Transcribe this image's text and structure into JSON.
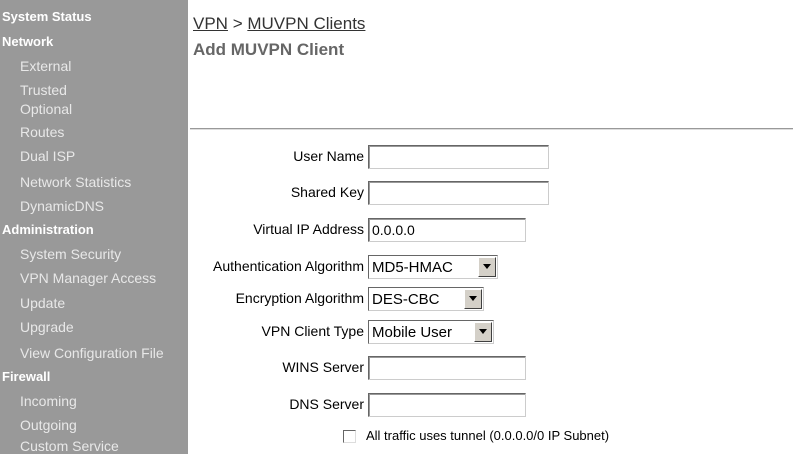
{
  "sidebar": {
    "system_status": "System Status",
    "network": {
      "label": "Network",
      "items": [
        "External",
        "Trusted",
        "Optional",
        "Routes",
        "Dual ISP",
        "Network Statistics",
        "DynamicDNS"
      ]
    },
    "administration": {
      "label": "Administration",
      "items": [
        "System Security",
        "VPN Manager Access",
        "Update",
        "Upgrade",
        "View Configuration File"
      ]
    },
    "firewall": {
      "label": "Firewall",
      "items": [
        "Incoming",
        "Outgoing",
        "Custom Service"
      ]
    }
  },
  "breadcrumb": {
    "part1": "VPN",
    "sep": " > ",
    "part2": "MUVPN Clients"
  },
  "page_title": "Add MUVPN Client",
  "form": {
    "user_name": {
      "label": "User Name",
      "value": ""
    },
    "shared_key": {
      "label": "Shared Key",
      "value": ""
    },
    "virtual_ip": {
      "label": "Virtual IP Address",
      "value": "0.0.0.0"
    },
    "auth_alg": {
      "label": "Authentication Algorithm",
      "value": "MD5-HMAC"
    },
    "enc_alg": {
      "label": "Encryption Algorithm",
      "value": "DES-CBC"
    },
    "client_type": {
      "label": "VPN Client Type",
      "value": "Mobile User"
    },
    "wins": {
      "label": "WINS Server",
      "value": ""
    },
    "dns": {
      "label": "DNS Server",
      "value": ""
    },
    "tunnel": {
      "label": "All traffic uses tunnel (0.0.0.0/0 IP Subnet)",
      "checked": false
    }
  },
  "colors": {
    "sidebar_bg": "#999999",
    "sidebar_text": "#ffffff"
  }
}
